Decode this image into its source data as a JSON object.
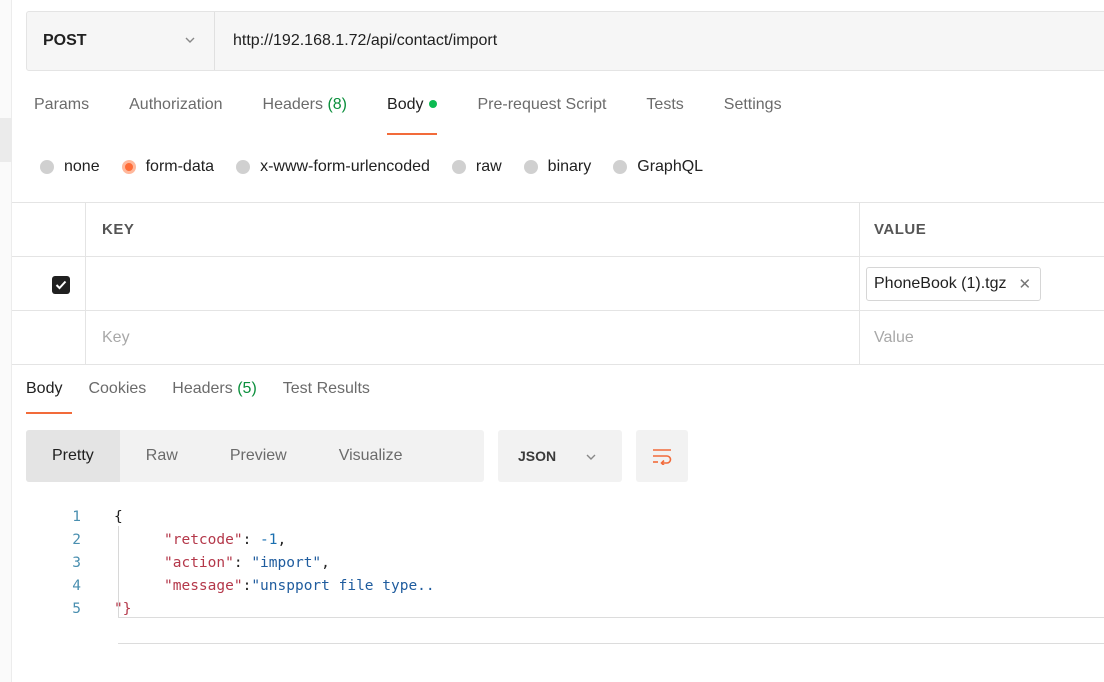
{
  "request": {
    "method": "POST",
    "url": "http://192.168.1.72/api/contact/import"
  },
  "req_tabs": [
    {
      "label": "Params"
    },
    {
      "label": "Authorization"
    },
    {
      "label": "Headers",
      "count": "(8)"
    },
    {
      "label": "Body"
    },
    {
      "label": "Pre-request Script"
    },
    {
      "label": "Tests"
    },
    {
      "label": "Settings"
    }
  ],
  "body_types": [
    "none",
    "form-data",
    "x-www-form-urlencoded",
    "raw",
    "binary",
    "GraphQL"
  ],
  "body_type_selected": "form-data",
  "kv_table": {
    "key_header": "KEY",
    "value_header": "VALUE",
    "rows": [
      {
        "checked": true,
        "key": "",
        "value": "PhoneBook (1).tgz"
      }
    ],
    "key_placeholder": "Key",
    "value_placeholder": "Value"
  },
  "res_tabs": [
    {
      "label": "Body"
    },
    {
      "label": "Cookies"
    },
    {
      "label": "Headers",
      "count": "(5)"
    },
    {
      "label": "Test Results"
    }
  ],
  "view_modes": [
    "Pretty",
    "Raw",
    "Preview",
    "Visualize"
  ],
  "view_mode_selected": "Pretty",
  "format": "JSON",
  "code": {
    "line_numbers": [
      "1",
      "2",
      "3",
      "4",
      "5"
    ],
    "open_brace": "{",
    "close": "\"}",
    "retcode_key": "\"retcode\"",
    "retcode_val": "-1",
    "action_key": "\"action\"",
    "action_val": "\"import\"",
    "message_key": "\"message\"",
    "message_val": "\"unspport file type..",
    "colon": ": ",
    "colon_tight": ":",
    "comma": ","
  },
  "colors": {
    "accent": "#ff6c37",
    "status_green": "#0cbb52",
    "count_green": "#0b8f3c"
  }
}
